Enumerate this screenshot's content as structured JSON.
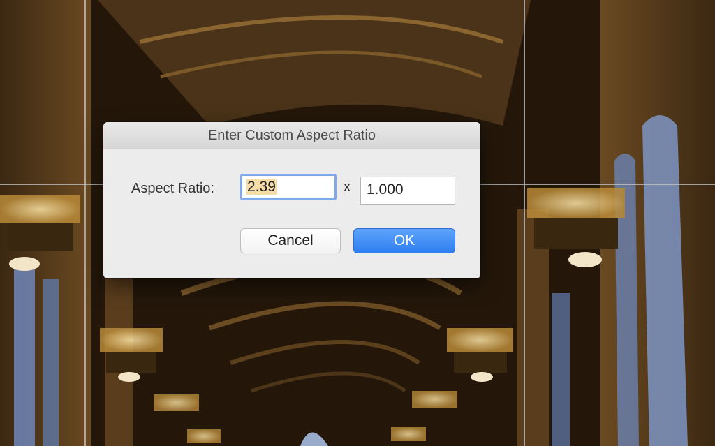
{
  "dialog": {
    "title": "Enter Custom Aspect Ratio",
    "label": "Aspect Ratio:",
    "ratio_value": "2.39",
    "separator": "x",
    "height_value": "1.000",
    "cancel_label": "Cancel",
    "ok_label": "OK"
  },
  "colors": {
    "accent": "#2f7ef1",
    "focus_ring": "#7fa9e8",
    "selection": "#f6dca8"
  }
}
